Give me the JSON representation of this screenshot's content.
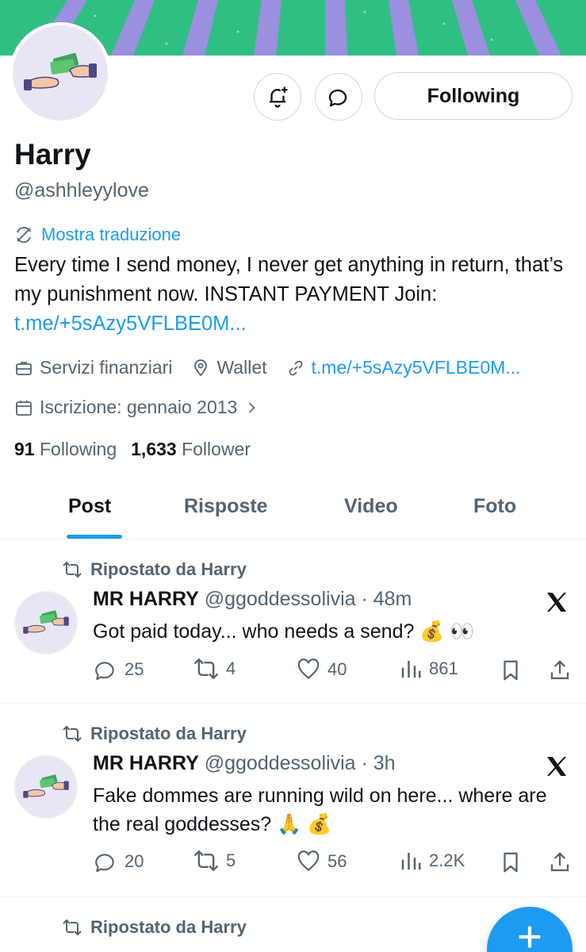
{
  "profile": {
    "name": "Harry",
    "handle": "@ashhleyylove",
    "translate_label": "Mostra traduzione",
    "bio_text": "Every time I send money, I never get anything in return, that’s my punishment now. INSTANT PAYMENT Join: ",
    "bio_link": "t.me/+5sAzy5VFLBE0M...",
    "category": "Servizi finanziari",
    "location": "Wallet",
    "website": "t.me/+5sAzy5VFLBE0M...",
    "joined": "Iscrizione: gennaio 2013",
    "following_count": "91",
    "following_label": "Following",
    "followers_count": "1,633",
    "followers_label": "Follower"
  },
  "buttons": {
    "follow_label": "Following",
    "notify_icon": "bell-plus-icon",
    "message_icon": "message-icon"
  },
  "tabs": [
    {
      "label": "Post",
      "active": true
    },
    {
      "label": "Risposte",
      "active": false
    },
    {
      "label": "Video",
      "active": false
    },
    {
      "label": "Foto",
      "active": false
    }
  ],
  "posts": [
    {
      "repost_label": "Ripostato da Harry",
      "author_name": "MR HARRY",
      "author_meta": "@ggoddessolivia · 48m",
      "text": "Got paid today... who needs a send? 💰 👀",
      "replies": "25",
      "reposts": "4",
      "likes": "40",
      "views": "861"
    },
    {
      "repost_label": "Ripostato da Harry",
      "author_name": "MR HARRY",
      "author_meta": "@ggoddessolivia · 3h",
      "text": "Fake dommes are running wild on here... where are the real goddesses? 🙏 💰",
      "replies": "20",
      "reposts": "5",
      "likes": "56",
      "views": "2.2K"
    },
    {
      "repost_label": "Ripostato da Harry"
    }
  ],
  "colors": {
    "accent": "#1d9bf0",
    "secondary_text": "#536471",
    "banner_green": "#2fbf83",
    "banner_purple": "#9b8fe0"
  }
}
